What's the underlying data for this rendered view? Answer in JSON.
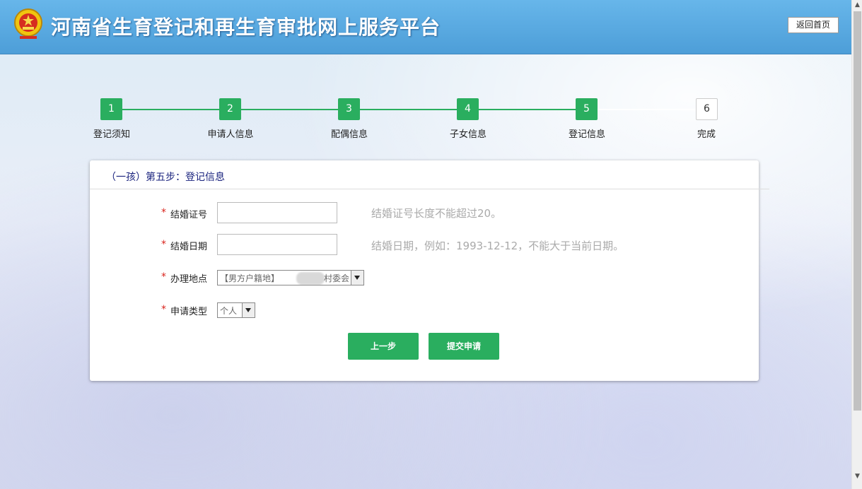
{
  "header": {
    "title": "河南省生育登记和再生育审批网上服务平台",
    "home_button": "返回首页"
  },
  "steps": [
    {
      "number": "1",
      "label": "登记须知",
      "done": true
    },
    {
      "number": "2",
      "label": "申请人信息",
      "done": true
    },
    {
      "number": "3",
      "label": "配偶信息",
      "done": true
    },
    {
      "number": "4",
      "label": "子女信息",
      "done": true
    },
    {
      "number": "5",
      "label": "登记信息",
      "done": true
    },
    {
      "number": "6",
      "label": "完成",
      "done": false
    }
  ],
  "form": {
    "title": "（一孩）第五步：登记信息",
    "required_mark": "*",
    "marriage_cert": {
      "label": "结婚证号",
      "value": "",
      "hint": "结婚证号长度不能超过20。"
    },
    "marriage_date": {
      "label": "结婚日期",
      "value": "",
      "hint": "结婚日期，例如：1993-12-12，不能大于当前日期。"
    },
    "location": {
      "label": "办理地点",
      "selected": "【男方户籍地】",
      "selected_suffix": "村委会"
    },
    "apply_type": {
      "label": "申请类型",
      "selected": "个人"
    },
    "prev_button": "上一步",
    "submit_button": "提交申请"
  },
  "colors": {
    "accent": "#2aae5f",
    "header": "#4d9ed8",
    "required": "#d9241c",
    "panel_title": "#1a237e"
  },
  "icons": {
    "emblem": "national-emblem-icon",
    "select_arrow": "chevron-down-icon"
  }
}
